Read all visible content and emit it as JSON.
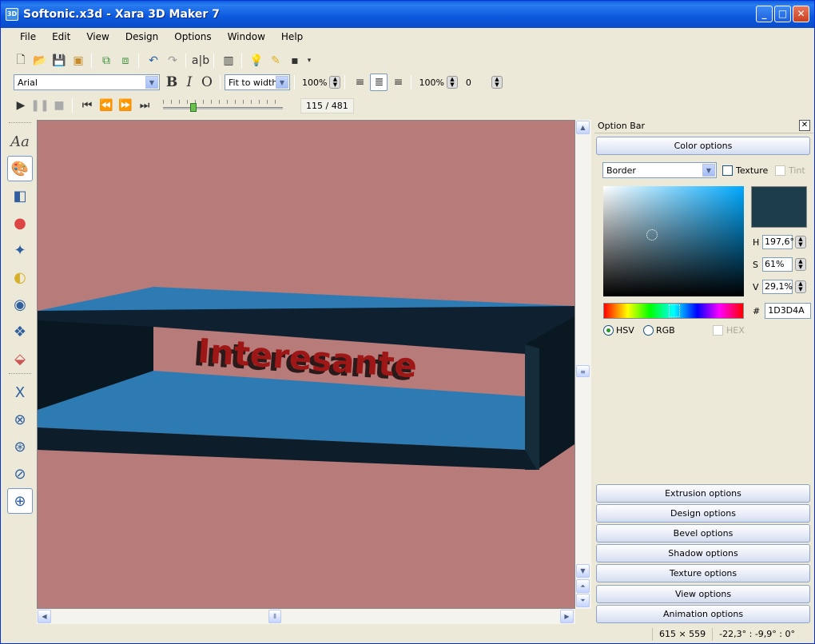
{
  "window": {
    "title": "Softonic.x3d - Xara 3D Maker 7",
    "icon_label": "3D"
  },
  "menu": [
    "File",
    "Edit",
    "View",
    "Design",
    "Options",
    "Window",
    "Help"
  ],
  "toolbar": {
    "font_name": "Arial",
    "view_mode": "Fit to width",
    "zoom": "100%",
    "line_spacing": "100%",
    "letter_spacing": "0",
    "bold_label": "B",
    "italic_label": "I",
    "outline_label": "O"
  },
  "playback": {
    "frame_readout": "115 / 481",
    "frame_current": 115,
    "frame_total": 481
  },
  "canvas": {
    "text": "Interesante",
    "background_color": "#b77b7a",
    "shape_color": "#2f7db5"
  },
  "option_bar": {
    "title": "Option Bar",
    "active_section": "Color options",
    "color": {
      "target": "Border",
      "texture_label": "Texture",
      "tint_label": "Tint",
      "h_label": "H",
      "h_value": "197,6°",
      "s_label": "S",
      "s_value": "61%",
      "v_label": "V",
      "v_value": "29,1%",
      "hex_label": "#",
      "hex_value": "1D3D4A",
      "swatch": "#1d3d4a",
      "mode_hsv": "HSV",
      "mode_rgb": "RGB",
      "mode_hex": "HEX"
    },
    "sections": [
      "Extrusion options",
      "Design options",
      "Bevel options",
      "Shadow options",
      "Texture options",
      "View options",
      "Animation options"
    ]
  },
  "status": {
    "dimensions": "615 × 559",
    "rotation": "-22,3° : -9,9° : 0°"
  }
}
